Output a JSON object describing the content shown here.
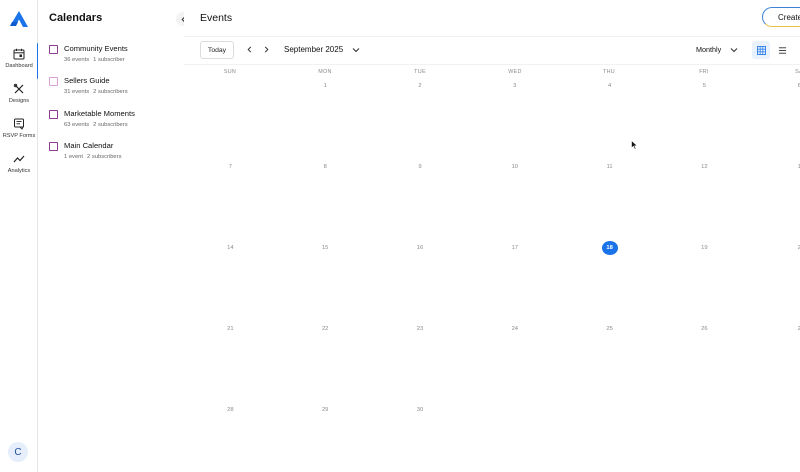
{
  "rail": {
    "items": [
      {
        "label": "Dashboard",
        "icon": "calendar-icon"
      },
      {
        "label": "Designs",
        "icon": "pencil-ruler-icon"
      },
      {
        "label": "RSVP Forms",
        "icon": "form-icon"
      },
      {
        "label": "Analytics",
        "icon": "trend-icon"
      }
    ],
    "avatar": "C",
    "brand_color": "#1a73e8"
  },
  "calendars": {
    "title": "Calendars",
    "items": [
      {
        "name": "Community Events",
        "events": "36 events",
        "subscribers": "1 subscriber",
        "color": "#8e3a8e"
      },
      {
        "name": "Sellers Guide",
        "events": "31 events",
        "subscribers": "2 subscribers",
        "color": "#d9a0d9"
      },
      {
        "name": "Marketable Moments",
        "events": "63 events",
        "subscribers": "2 subscribers",
        "color": "#8e3a8e"
      },
      {
        "name": "Main Calendar",
        "events": "1 event",
        "subscribers": "2 subscribers",
        "color": "#8e3a8e"
      }
    ]
  },
  "main": {
    "title": "Events",
    "create_label": "Create",
    "today_label": "Today",
    "month_label": "September 2025",
    "view_label": "Monthly",
    "weekdays": [
      "SUN",
      "MON",
      "TUE",
      "WED",
      "THU",
      "FRI",
      "SA"
    ],
    "weeks": [
      [
        "",
        "1",
        "2",
        "3",
        "4",
        "5",
        "6"
      ],
      [
        "7",
        "8",
        "9",
        "10",
        "11",
        "12",
        "1"
      ],
      [
        "14",
        "15",
        "16",
        "17",
        "18",
        "19",
        "2"
      ],
      [
        "21",
        "22",
        "23",
        "24",
        "25",
        "26",
        "2"
      ],
      [
        "28",
        "29",
        "30",
        "",
        "",
        "",
        ""
      ]
    ],
    "today": "18",
    "today_color": "#1a73e8"
  }
}
